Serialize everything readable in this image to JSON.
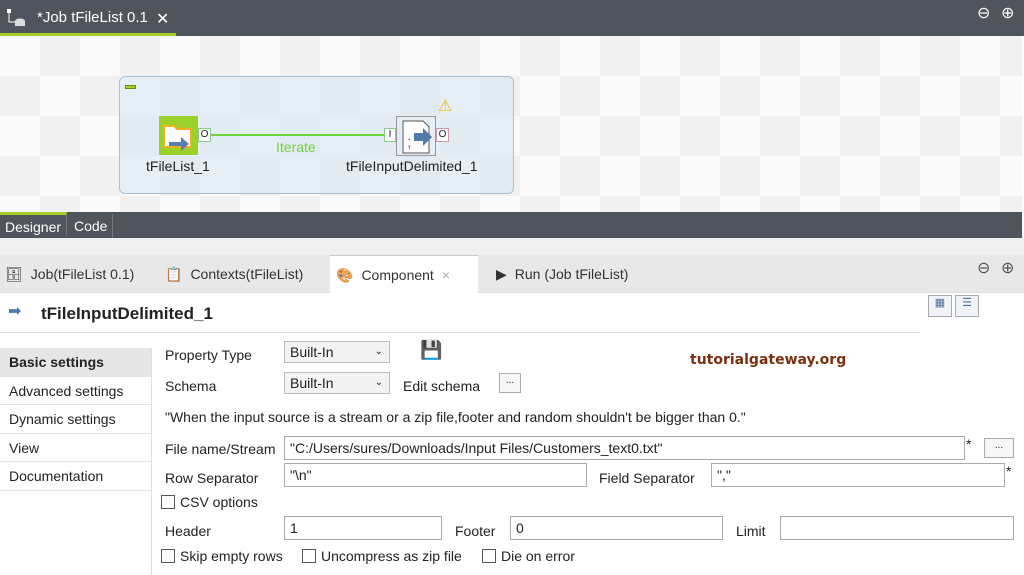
{
  "editor": {
    "job_tab": "*Job tFileList 0.1",
    "designer_tab": "Designer",
    "code_tab": "Code"
  },
  "canvas": {
    "component1": "tFileList_1",
    "component2": "tFileInputDelimited_1",
    "link_label": "Iterate",
    "port_out": "O",
    "port_in": "I"
  },
  "bottom_tabs": [
    {
      "label": "Job(tFileList 0.1)"
    },
    {
      "label": "Contexts(tFileList)"
    },
    {
      "label": "Component",
      "close": "×"
    },
    {
      "label": "Run (Job tFileList)"
    }
  ],
  "component": {
    "title": "tFileInputDelimited_1"
  },
  "watermark": "tutorialgateway.org",
  "sidebar": [
    "Basic settings",
    "Advanced settings",
    "Dynamic settings",
    "View",
    "Documentation"
  ],
  "form": {
    "property_type_label": "Property Type",
    "property_type_value": "Built-In",
    "schema_label": "Schema",
    "schema_value": "Built-In",
    "edit_schema": "Edit schema",
    "dots": "...",
    "notice": "\"When the input source is a stream or a zip file,footer and random shouldn't be bigger than 0.\"",
    "file_label": "File name/Stream",
    "file_value": "\"C:/Users/sures/Downloads/Input Files/Customers_text0.txt\"",
    "row_sep_label": "Row Separator",
    "row_sep_value": "\"\\n\"",
    "field_sep_label": "Field Separator",
    "field_sep_value": "\",\"",
    "csv_label": "CSV options",
    "header_label": "Header",
    "header_value": "1",
    "footer_label": "Footer",
    "footer_value": "0",
    "limit_label": "Limit",
    "limit_value": "",
    "skip_label": "Skip empty rows",
    "zip_label": "Uncompress as zip file",
    "die_label": "Die on error",
    "required": "*"
  }
}
